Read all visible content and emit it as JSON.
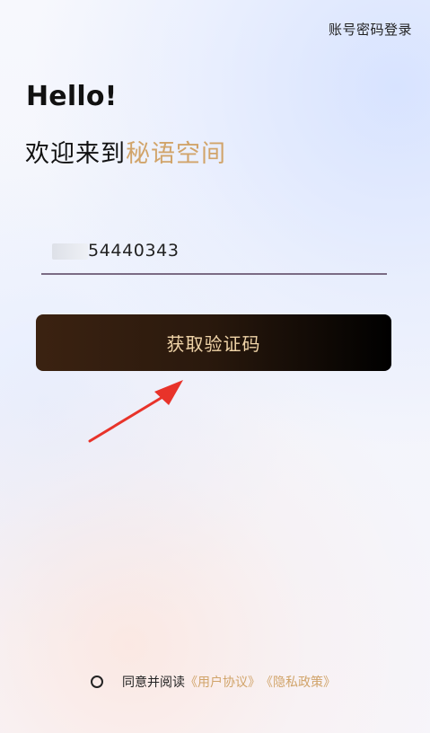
{
  "top_link": {
    "label": "账号密码登录"
  },
  "greeting": {
    "title": "Hello!",
    "welcome_prefix": "欢迎来到",
    "brand_name": "秘语空间"
  },
  "phone_field": {
    "value": "54440343"
  },
  "primary_action": {
    "label": "获取验证码"
  },
  "agreement": {
    "prefix": "同意并阅读",
    "user_agreement": "《用户协议》",
    "privacy_policy": "《隐私政策》"
  },
  "colors": {
    "accent": "#d1a46a",
    "button_start": "#3b2211",
    "button_end": "#000000",
    "annotation_arrow": "#e8332a"
  }
}
